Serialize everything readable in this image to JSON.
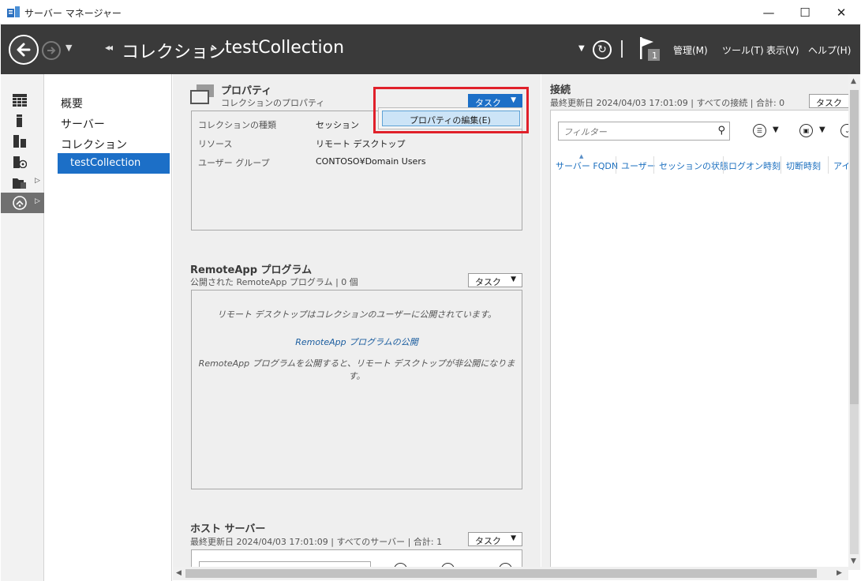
{
  "window": {
    "title": "サーバー マネージャー",
    "minimize": "—",
    "maximize": "☐",
    "close": "✕"
  },
  "header": {
    "breadcrumb": [
      "コレクション",
      "testCollection"
    ],
    "menus": [
      "管理(M)",
      "ツール(T)",
      "表示(V)",
      "ヘルプ(H)"
    ],
    "notification_count": "1"
  },
  "rail": {
    "icons": [
      "dashboard-icon",
      "local-server-icon",
      "all-servers-icon",
      "file-storage-icon",
      "folder-services-icon",
      "remote-desktop-icon"
    ]
  },
  "nav": {
    "items": [
      "概要",
      "サーバー",
      "コレクション"
    ],
    "selected": "testCollection"
  },
  "properties": {
    "title": "プロパティ",
    "subtitle": "コレクションのプロパティ",
    "task_label": "タスク",
    "rows": [
      {
        "key": "コレクションの種類",
        "value": "セッション"
      },
      {
        "key": "リソース",
        "value": "リモート デスクトップ"
      },
      {
        "key": "ユーザー グループ",
        "value": "CONTOSO¥Domain Users"
      }
    ],
    "dropdown_item": "プロパティの編集(E)"
  },
  "remoteapp": {
    "title": "RemoteApp プログラム",
    "subtitle": "公開された RemoteApp プログラム | 0 個",
    "task_label": "タスク",
    "line1": "リモート デスクトップはコレクションのユーザーに公開されています。",
    "link": "RemoteApp プログラムの公開",
    "line2": "RemoteApp プログラムを公開すると、リモート デスクトップが非公開になります。"
  },
  "hosts": {
    "title": "ホスト サーバー",
    "subtitle": "最終更新日 2024/04/03 17:01:09 | すべてのサーバー | 合計: 1",
    "task_label": "タスク"
  },
  "connections": {
    "title": "接続",
    "subtitle": "最終更新日 2024/04/03 17:01:09 | すべての接続 | 合計: 0",
    "task_label": "タスク",
    "filter_placeholder": "フィルター",
    "columns": [
      "サーバー FQDN",
      "ユーザー",
      "セッションの状態",
      "ログオン時刻",
      "切断時刻",
      "アイ"
    ]
  },
  "colors": {
    "accent": "#1c6fc7",
    "header_bg": "#3a3a3a",
    "highlight": "#e0202a"
  }
}
